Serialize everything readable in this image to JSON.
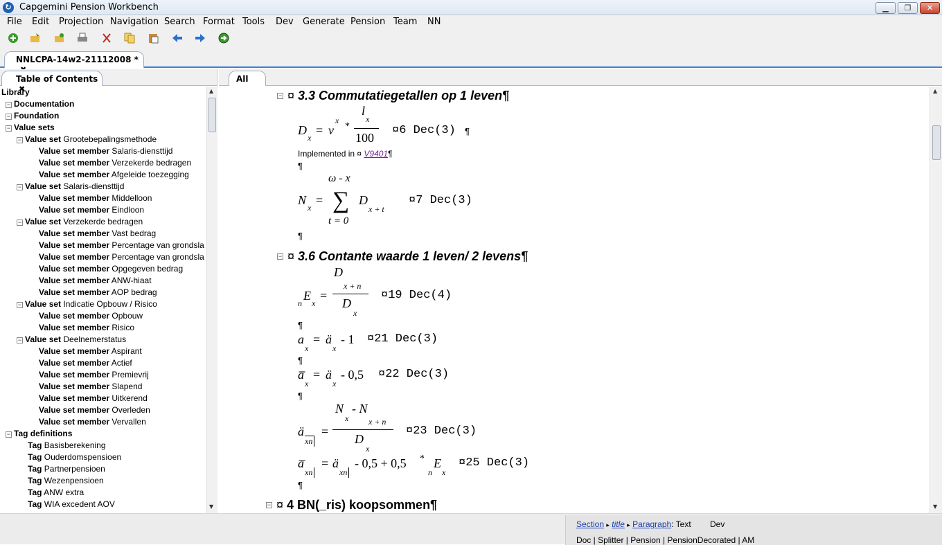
{
  "window": {
    "title": "Capgemini Pension Workbench",
    "minimize": "▁",
    "maximize": "❐",
    "close": "✕"
  },
  "menu": [
    "File",
    "Edit",
    "Projection",
    "Navigation",
    "Search",
    "Format",
    "Tools",
    "Dev",
    "Generate",
    "Pension",
    "Team",
    "NN"
  ],
  "toolbar_icons": [
    "new-icon",
    "open-icon",
    "open-folder-icon",
    "print-icon",
    "cut-icon",
    "copy-icon",
    "paste-icon",
    "back-icon",
    "forward-icon",
    "go-icon"
  ],
  "editor_tab": {
    "label": "NNLCPA-14w2-21112008 *",
    "close": "✖"
  },
  "toc": {
    "tab_label": "Table of Contents",
    "tab_close": "✖",
    "rows": [
      {
        "indent": 0,
        "exp": "",
        "bold": "Library",
        "text": ""
      },
      {
        "indent": 1,
        "exp": "−",
        "bold": "Documentation",
        "text": ""
      },
      {
        "indent": 1,
        "exp": "−",
        "bold": "Foundation",
        "text": ""
      },
      {
        "indent": 2,
        "exp": "−",
        "bold": "Value sets",
        "text": ""
      },
      {
        "indent": 3,
        "exp": "−",
        "bold": "Value set",
        "text": " Grootebepalingsmethode"
      },
      {
        "indent": 4,
        "exp": "",
        "bold": "Value set member",
        "text": " Salaris-diensttijd"
      },
      {
        "indent": 4,
        "exp": "",
        "bold": "Value set member",
        "text": " Verzekerde bedragen"
      },
      {
        "indent": 4,
        "exp": "",
        "bold": "Value set member",
        "text": " Afgeleide toezegging"
      },
      {
        "indent": 3,
        "exp": "−",
        "bold": "Value set",
        "text": " Salaris-diensttijd"
      },
      {
        "indent": 4,
        "exp": "",
        "bold": "Value set member",
        "text": " Middelloon"
      },
      {
        "indent": 4,
        "exp": "",
        "bold": "Value set member",
        "text": " Eindloon"
      },
      {
        "indent": 3,
        "exp": "−",
        "bold": "Value set",
        "text": " Verzekerde bedragen"
      },
      {
        "indent": 4,
        "exp": "",
        "bold": "Value set member",
        "text": " Vast bedrag"
      },
      {
        "indent": 4,
        "exp": "",
        "bold": "Value set member",
        "text": " Percentage van grondsla"
      },
      {
        "indent": 4,
        "exp": "",
        "bold": "Value set member",
        "text": " Percentage van grondsla"
      },
      {
        "indent": 4,
        "exp": "",
        "bold": "Value set member",
        "text": " Opgegeven bedrag"
      },
      {
        "indent": 4,
        "exp": "",
        "bold": "Value set member",
        "text": " ANW-hiaat"
      },
      {
        "indent": 4,
        "exp": "",
        "bold": "Value set member",
        "text": " AOP bedrag"
      },
      {
        "indent": 3,
        "exp": "−",
        "bold": "Value set",
        "text": " Indicatie Opbouw / Risico"
      },
      {
        "indent": 4,
        "exp": "",
        "bold": "Value set member",
        "text": " Opbouw"
      },
      {
        "indent": 4,
        "exp": "",
        "bold": "Value set member",
        "text": " Risico"
      },
      {
        "indent": 3,
        "exp": "−",
        "bold": "Value set",
        "text": " Deelnemerstatus"
      },
      {
        "indent": 4,
        "exp": "",
        "bold": "Value set member",
        "text": " Aspirant"
      },
      {
        "indent": 4,
        "exp": "",
        "bold": "Value set member",
        "text": " Actief"
      },
      {
        "indent": 4,
        "exp": "",
        "bold": "Value set member",
        "text": " Premievrij"
      },
      {
        "indent": 4,
        "exp": "",
        "bold": "Value set member",
        "text": " Slapend"
      },
      {
        "indent": 4,
        "exp": "",
        "bold": "Value set member",
        "text": " Uitkerend"
      },
      {
        "indent": 4,
        "exp": "",
        "bold": "Value set member",
        "text": " Overleden"
      },
      {
        "indent": 4,
        "exp": "",
        "bold": "Value set member",
        "text": " Vervallen"
      },
      {
        "indent": 2,
        "exp": "−",
        "bold": "Tag definitions",
        "text": ""
      },
      {
        "indent": 3,
        "exp": "",
        "bold": "Tag",
        "text": " Basisberekening"
      },
      {
        "indent": 3,
        "exp": "",
        "bold": "Tag",
        "text": " Ouderdomspensioen"
      },
      {
        "indent": 3,
        "exp": "",
        "bold": "Tag",
        "text": " Partnerpensioen"
      },
      {
        "indent": 3,
        "exp": "",
        "bold": "Tag",
        "text": " Wezenpensioen"
      },
      {
        "indent": 3,
        "exp": "",
        "bold": "Tag",
        "text": " ANW extra"
      },
      {
        "indent": 3,
        "exp": "",
        "bold": "Tag",
        "text": " WIA excedent AOV"
      }
    ]
  },
  "doc": {
    "tab_label": "All",
    "pilcrow": "¶",
    "currency": "¤",
    "section_33": "3.3 Commutatiegetallen op 1 leven¶",
    "section_36": "3.6 Contante waarde  1 leven/ 2 levens¶",
    "section_4": "4 BN(_ris) koopsommen¶",
    "implemented_in": "Implemented in ¤ ",
    "implemented_link": "V9401",
    "ann_6": "¤6 Dec(3)",
    "ann_7": "¤7 Dec(3)",
    "ann_19": "¤19 Dec(4)",
    "ann_21": "¤21 Dec(3)",
    "ann_22": "¤22 Dec(3)",
    "ann_23": "¤23 Dec(3)",
    "ann_25": "¤25 Dec(3)",
    "f1": {
      "D": "D",
      "x": "x",
      "eq": "=",
      "v": "v",
      "star": "*",
      "l": "l",
      "hundred": "100"
    },
    "f2": {
      "omega": "ω - x",
      "N": "N",
      "sum": "∑",
      "t0": "t = 0",
      "D": "D",
      "xt": "x + t"
    },
    "f3": {
      "D": "D",
      "xn": "x + n",
      "E": "E",
      "n": "n"
    },
    "f4": {
      "a": "a",
      "adot": "ä",
      "minus1": "- 1"
    },
    "f5": {
      "abar": "a̅",
      "minus05": "- 0,5"
    },
    "f6": {
      "N": "N",
      "minusN": "- N",
      "xn": "xn"
    },
    "f7": {
      "rest": "- 0,5 + 0,5",
      "E": "E"
    }
  },
  "status": {
    "section": "Section",
    "title": "title",
    "paragraph": "Paragraph",
    "suffix": ": Text",
    "mode": "Dev",
    "line2": "Doc | Splitter | Pension | PensionDecorated | AM",
    "sep": "▸"
  }
}
